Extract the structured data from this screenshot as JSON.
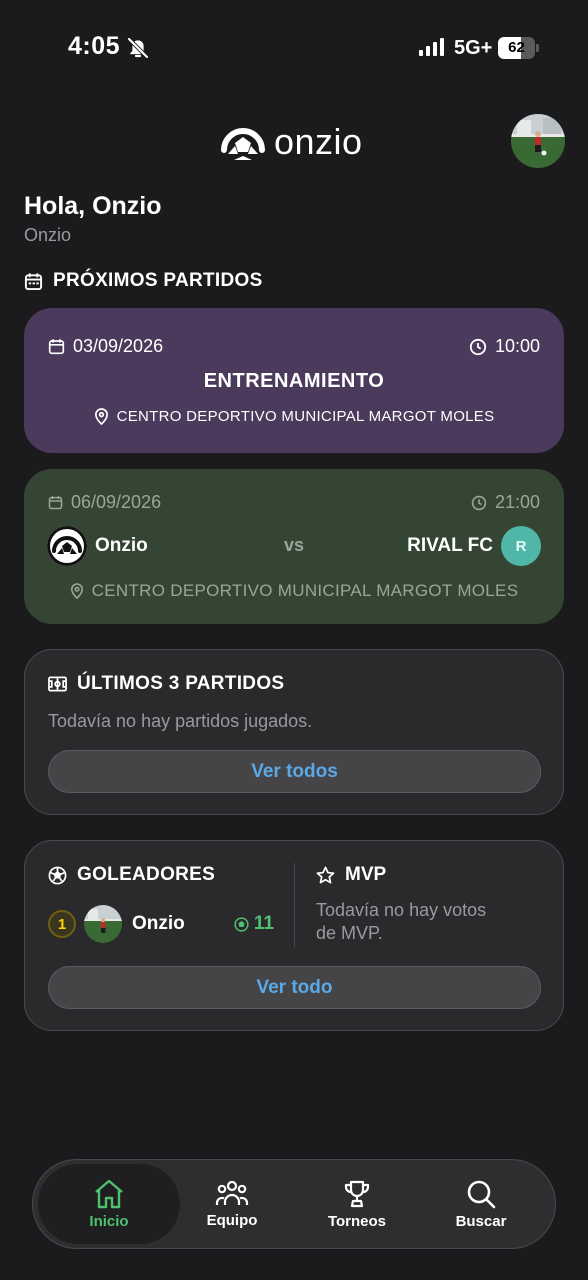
{
  "status_bar": {
    "time": "4:05",
    "network": "5G+",
    "battery": "62",
    "battery_level": 0.62
  },
  "header": {
    "app_name": "onzio"
  },
  "greeting": {
    "title": "Hola, Onzio",
    "subtitle": "Onzio"
  },
  "upcoming": {
    "section_title": "PRÓXIMOS PARTIDOS",
    "training": {
      "date": "03/09/2026",
      "time": "10:00",
      "title": "ENTRENAMIENTO",
      "location": "CENTRO DEPORTIVO MUNICIPAL MARGOT MOLES"
    },
    "match": {
      "date": "06/09/2026",
      "time": "21:00",
      "home_team": "Onzio",
      "vs": "vs",
      "away_team": "RIVAL FC",
      "away_badge": "R",
      "location": "CENTRO DEPORTIVO MUNICIPAL MARGOT MOLES"
    }
  },
  "last_matches": {
    "title": "ÚLTIMOS 3 PARTIDOS",
    "empty_text": "Todavía no hay partidos jugados.",
    "button": "Ver todos"
  },
  "scorers": {
    "title": "GOLEADORES",
    "players": [
      {
        "rank": "1",
        "name": "Onzio",
        "goals": "11"
      }
    ],
    "mvp_title": "MVP",
    "mvp_line1": "Todavía no hay votos",
    "mvp_line2": "de MVP.",
    "button": "Ver todo"
  },
  "tabbar": {
    "items": [
      {
        "label": "Inicio",
        "icon": "home-icon",
        "active": true
      },
      {
        "label": "Equipo",
        "icon": "team-icon"
      },
      {
        "label": "Torneos",
        "icon": "trophy-icon"
      },
      {
        "label": "Buscar",
        "icon": "search-icon"
      }
    ]
  },
  "colors": {
    "background": "#1b1b1d",
    "training_card": "#4b3a5c",
    "match_card": "#344633",
    "accent_link": "#5aa8e6",
    "active_tab": "#4fc06e",
    "rival_badge": "#4fb6a8",
    "rank_gold": "#e0b800"
  }
}
